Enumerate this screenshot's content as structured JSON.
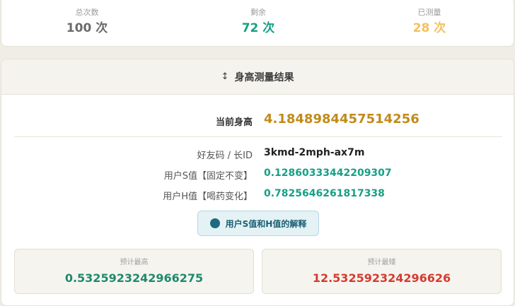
{
  "stats": {
    "total_label": "总次数",
    "total_value": "100 次",
    "remaining_label": "剩余",
    "remaining_value": "72 次",
    "measured_label": "已测量",
    "measured_value": "28 次"
  },
  "result": {
    "header_arrow": "↕",
    "header_title": "身高测量结果",
    "current_height_label": "当前身高",
    "current_height_value": "4.1848984457514256",
    "friend_code_label": "好友码 / 长ID",
    "friend_code_value": "3kmd-2mph-ax7m",
    "s_label": "用户S值【固定不变】",
    "s_value": "0.12860333442209307",
    "h_label": "用户H值【喝药变化】",
    "h_value": "0.7825646261817338",
    "explain_button": "用户S值和H值的解释",
    "pred_max_label": "预计最高",
    "pred_max_value": "0.5325923242966275",
    "pred_min_label": "预计最矮",
    "pred_min_value": "12.532592324296626"
  },
  "colors": {
    "total": "#6b6b6b",
    "remaining": "#16a085",
    "measured": "#f3c15f",
    "height": "#c08b1b",
    "teal_value": "#16a085",
    "pred_max": "#1e8a6e",
    "pred_min": "#d63a2f"
  }
}
